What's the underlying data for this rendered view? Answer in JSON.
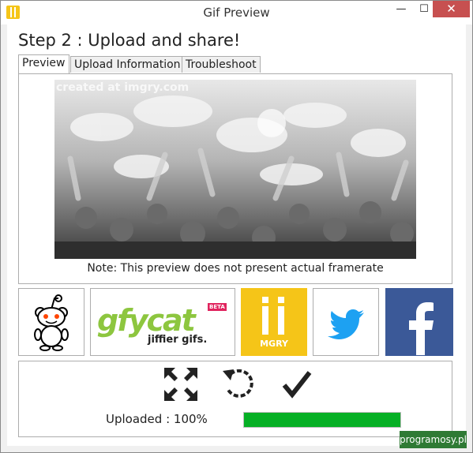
{
  "window": {
    "title": "Gif Preview",
    "minimize_glyph": "—",
    "maximize_glyph": "☐",
    "close_glyph": "✕"
  },
  "step_title": "Step 2 : Upload and share!",
  "tabs": [
    {
      "label": "Preview",
      "active": true
    },
    {
      "label": "Upload Information",
      "active": false
    },
    {
      "label": "Troubleshoot",
      "active": false
    }
  ],
  "preview": {
    "watermark": "created at imgry.com",
    "note": "Note: This preview does not present actual framerate"
  },
  "share_buttons": [
    {
      "name": "reddit",
      "icon": "reddit-alien-icon",
      "color": "#ff4500"
    },
    {
      "name": "gfycat",
      "text": "gfycat",
      "tagline": "jiffier gifs.",
      "badge": "BETA"
    },
    {
      "name": "imgry",
      "text": "MGRY",
      "color": "#f5c518"
    },
    {
      "name": "twitter",
      "icon": "twitter-bird-icon",
      "color": "#1da1f2"
    },
    {
      "name": "facebook",
      "icon": "facebook-f-icon",
      "color": "#3b5998"
    }
  ],
  "actions": [
    {
      "name": "fullscreen",
      "icon": "expand-arrows-icon"
    },
    {
      "name": "retry",
      "icon": "rotate-ccw-icon"
    },
    {
      "name": "confirm",
      "icon": "checkmark-icon"
    }
  ],
  "upload": {
    "label": "Uploaded : 100%",
    "progress": 1.0,
    "progress_color": "#06b025"
  },
  "footer_watermark": "programosy.pl"
}
